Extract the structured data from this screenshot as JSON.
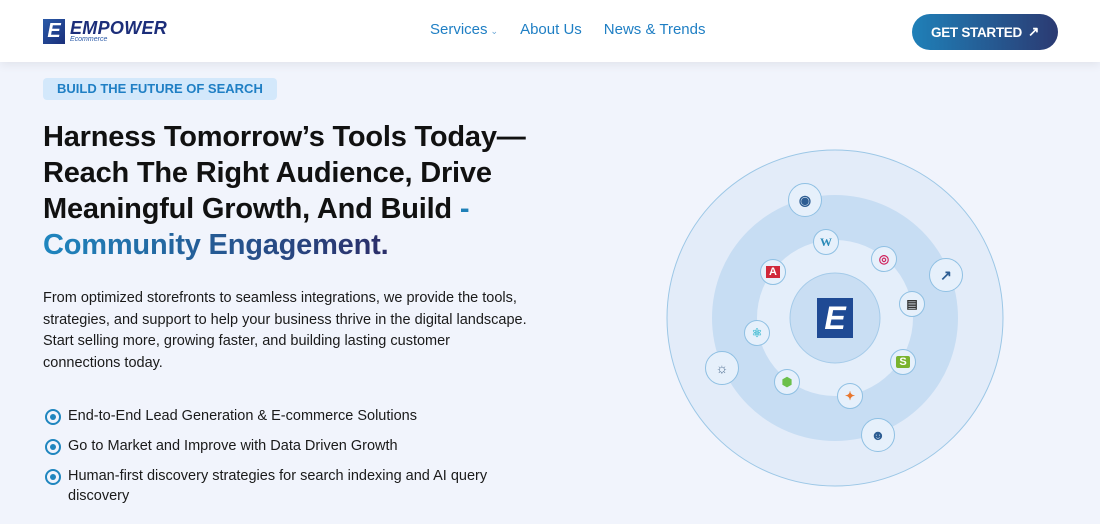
{
  "header": {
    "logo": {
      "name": "EMPOWER",
      "sub": "Ecommerce",
      "mark": "E"
    },
    "nav": [
      {
        "label": "Services",
        "has_dropdown": true
      },
      {
        "label": "About Us"
      },
      {
        "label": "News & Trends"
      }
    ],
    "cta": {
      "label": "GET STARTED",
      "icon": "arrow-up-right-icon"
    }
  },
  "hero": {
    "badge": "BUILD THE FUTURE OF SEARCH",
    "title_lines": [
      "Harness Tomorrow’s Tools Today—",
      "Reach The Right Audience, Drive",
      "Meaningful Growth, And Build"
    ],
    "title_dash": "-",
    "title_highlight": "Community Engagement",
    "title_end": ".",
    "paragraph_lines": [
      "From optimized storefronts to seamless integrations, we provide the tools,",
      "strategies, and support to help your business thrive in the digital landscape.",
      "Start selling more, growing faster, and building lasting customer",
      "connections today."
    ],
    "features": [
      "End-to-End Lead Generation & E-commerce Solutions",
      "Go to Market and Improve with Data Driven Growth",
      "Human-first discovery strategies for search indexing and AI query discovery"
    ]
  },
  "diagram": {
    "center_mark": "E",
    "icons": [
      "hand-coin-icon",
      "wordpress-icon",
      "target-icon",
      "angular-icon",
      "growth-chart-icon",
      "power-bi-icon",
      "react-icon",
      "lightbulb-icon",
      "shopify-icon",
      "green-app-icon",
      "tableau-icon",
      "people-icon"
    ],
    "colors": {
      "outer": "#e3ecf9",
      "ring": "#c7ddf3",
      "inner": "#dde9f8",
      "accent": "#1f86bf"
    }
  }
}
